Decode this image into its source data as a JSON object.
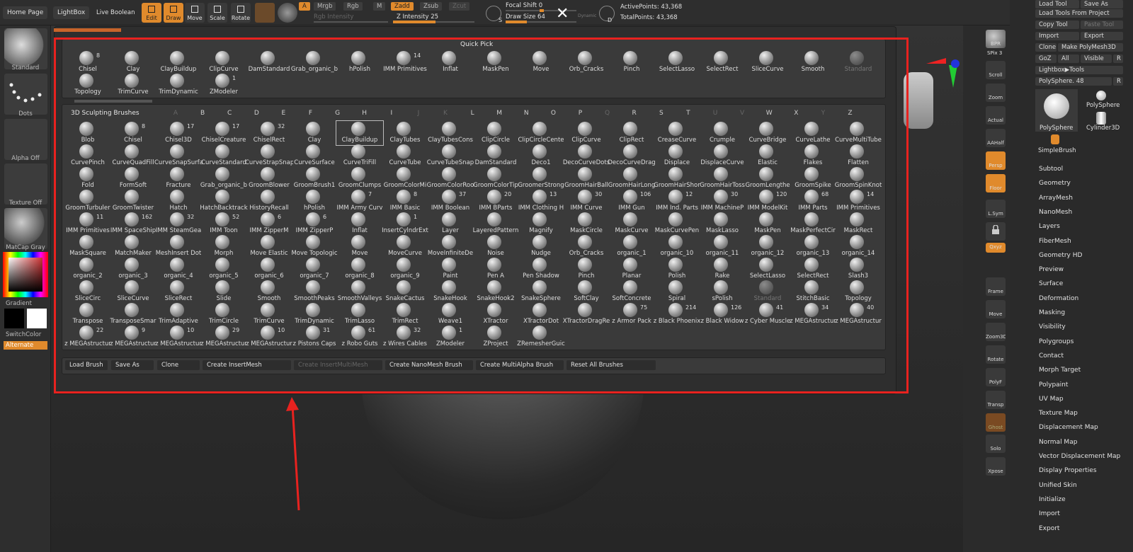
{
  "topbar": {
    "home": "Home Page",
    "lightbox": "LightBox",
    "live_boolean": "Live Boolean",
    "tools": [
      {
        "label": "Edit",
        "icon": "edit-icon",
        "on": true
      },
      {
        "label": "Draw",
        "icon": "draw-icon",
        "on": true
      },
      {
        "label": "Move",
        "icon": "move-icon",
        "on": false
      },
      {
        "label": "Scale",
        "icon": "scale-icon",
        "on": false
      },
      {
        "label": "Rotate",
        "icon": "rotate-icon",
        "on": false
      }
    ],
    "a_label": "A",
    "mrgb": "Mrgb",
    "rgb": "Rgb",
    "m": "M",
    "zadd": "Zadd",
    "zsub": "Zsub",
    "zcut": "Zcut",
    "rgb_intensity": "Rgb Intensity",
    "z_intensity": "Z Intensity 25",
    "focal_shift": "Focal Shift 0",
    "draw_size": "Draw Size 64",
    "s_label": "S",
    "d_label": "D",
    "dynamic": "Dynamic",
    "active_points": "ActivePoints: 43,368",
    "total_points": "TotalPoints: 43,368",
    "close": "✕"
  },
  "left": {
    "standard": "Standard",
    "dots": "Dots",
    "alpha": "Alpha Off",
    "texture": "Texture Off",
    "matcap": "MatCap Gray",
    "gradient": "Gradient",
    "switch": "SwitchColor",
    "alternate": "Alternate"
  },
  "quick_pick": {
    "title": "Quick Pick",
    "items": [
      {
        "n": "Chisel",
        "c": "8"
      },
      {
        "n": "Clay",
        "c": ""
      },
      {
        "n": "ClayBuildup",
        "c": ""
      },
      {
        "n": "ClipCurve",
        "c": ""
      },
      {
        "n": "DamStandard",
        "c": ""
      },
      {
        "n": "Grab_organic_b",
        "c": ""
      },
      {
        "n": "hPolish",
        "c": ""
      },
      {
        "n": "IMM Primitives",
        "c": "14"
      },
      {
        "n": "Inflat",
        "c": ""
      },
      {
        "n": "MaskPen",
        "c": ""
      },
      {
        "n": "Move",
        "c": ""
      },
      {
        "n": "Orb_Cracks",
        "c": ""
      },
      {
        "n": "Pinch",
        "c": ""
      },
      {
        "n": "SelectLasso",
        "c": ""
      },
      {
        "n": "SelectRect",
        "c": ""
      },
      {
        "n": "SliceCurve",
        "c": ""
      },
      {
        "n": "Smooth",
        "c": ""
      },
      {
        "n": "Standard",
        "c": "",
        "dim": true
      },
      {
        "n": "Topology",
        "c": ""
      },
      {
        "n": "TrimCurve",
        "c": ""
      },
      {
        "n": "TrimDynamic",
        "c": ""
      },
      {
        "n": "ZModeler",
        "c": "1"
      }
    ]
  },
  "brushes": {
    "title": "3D Sculpting Brushes",
    "letters": [
      "A",
      "B",
      "C",
      "D",
      "E",
      "F",
      "G",
      "H",
      "I",
      "J",
      "K",
      "L",
      "M",
      "N",
      "O",
      "P",
      "Q",
      "R",
      "S",
      "T",
      "U",
      "V",
      "W",
      "X",
      "Y",
      "Z"
    ],
    "dim_letters": [
      "A",
      "J",
      "K",
      "Q",
      "U",
      "V",
      "Y"
    ],
    "rows": [
      [
        {
          "n": "Blob"
        },
        {
          "n": "Chisel",
          "c": "8"
        },
        {
          "n": "Chisel3D",
          "c": "17"
        },
        {
          "n": "ChiselCreature",
          "c": "17"
        },
        {
          "n": "ChiselRect",
          "c": "32"
        },
        {
          "n": "Clay"
        },
        {
          "n": "ClayBuildup",
          "sel": true
        },
        {
          "n": "ClayTubes"
        },
        {
          "n": "ClayTubesCons"
        },
        {
          "n": "ClipCircle"
        },
        {
          "n": "ClipCircleCente"
        },
        {
          "n": "ClipCurve"
        },
        {
          "n": "ClipRect"
        },
        {
          "n": "CreaseCurve"
        },
        {
          "n": "Crumple"
        },
        {
          "n": "CurveBridge"
        },
        {
          "n": "CurveLathe"
        },
        {
          "n": "CurveMultiTube"
        }
      ],
      [
        {
          "n": "CurvePinch"
        },
        {
          "n": "CurveQuadFill"
        },
        {
          "n": "CurveSnapSurfa"
        },
        {
          "n": "CurveStandard"
        },
        {
          "n": "CurveStrapSnap"
        },
        {
          "n": "CurveSurface"
        },
        {
          "n": "CurveTriFill"
        },
        {
          "n": "CurveTube"
        },
        {
          "n": "CurveTubeSnap"
        },
        {
          "n": "DamStandard"
        },
        {
          "n": "Deco1"
        },
        {
          "n": "DecoCurveDots"
        },
        {
          "n": "DecoCurveDrag"
        },
        {
          "n": "Displace"
        },
        {
          "n": "DisplaceCurve"
        },
        {
          "n": "Elastic"
        },
        {
          "n": "Flakes"
        },
        {
          "n": "Flatten"
        }
      ],
      [
        {
          "n": "Fold"
        },
        {
          "n": "FormSoft"
        },
        {
          "n": "Fracture"
        },
        {
          "n": "Grab_organic_b"
        },
        {
          "n": "GroomBlower"
        },
        {
          "n": "GroomBrush1"
        },
        {
          "n": "GroomClumps"
        },
        {
          "n": "GroomColorMi"
        },
        {
          "n": "GroomColorRoo"
        },
        {
          "n": "GroomColorTip"
        },
        {
          "n": "GroomerStrong"
        },
        {
          "n": "GroomHairBall"
        },
        {
          "n": "GroomHairLong"
        },
        {
          "n": "GroomHairShor"
        },
        {
          "n": "GroomHairToss"
        },
        {
          "n": "GroomLengthe"
        },
        {
          "n": "GroomSpike"
        },
        {
          "n": "GroomSpinKnot"
        }
      ],
      [
        {
          "n": "GroomTurbuler"
        },
        {
          "n": "GroomTwister"
        },
        {
          "n": "Hatch"
        },
        {
          "n": "HatchBacktrack"
        },
        {
          "n": "HistoryRecall"
        },
        {
          "n": "hPolish"
        },
        {
          "n": "IMM Army Curv",
          "c": "7"
        },
        {
          "n": "IMM Basic",
          "c": "8"
        },
        {
          "n": "IMM Boolean",
          "c": "37"
        },
        {
          "n": "IMM BParts",
          "c": "20"
        },
        {
          "n": "IMM Clothing H",
          "c": "13"
        },
        {
          "n": "IMM Curve",
          "c": "30"
        },
        {
          "n": "IMM Gun",
          "c": "106"
        },
        {
          "n": "IMM Ind. Parts",
          "c": "12"
        },
        {
          "n": "IMM MachineP",
          "c": "30"
        },
        {
          "n": "IMM ModelKit",
          "c": "120"
        },
        {
          "n": "IMM Parts",
          "c": "68"
        },
        {
          "n": "IMM Primitives",
          "c": "14"
        }
      ],
      [
        {
          "n": "IMM Primitives",
          "c": "11"
        },
        {
          "n": "IMM SpaceShip",
          "c": "162"
        },
        {
          "n": "IMM SteamGea",
          "c": "32"
        },
        {
          "n": "IMM Toon",
          "c": "52"
        },
        {
          "n": "IMM ZipperM",
          "c": "6"
        },
        {
          "n": "IMM ZipperP",
          "c": "6"
        },
        {
          "n": "Inflat"
        },
        {
          "n": "InsertCylndrExt",
          "c": "1"
        },
        {
          "n": "Layer"
        },
        {
          "n": "LayeredPattern"
        },
        {
          "n": "Magnify"
        },
        {
          "n": "MaskCircle"
        },
        {
          "n": "MaskCurve"
        },
        {
          "n": "MaskCurvePen"
        },
        {
          "n": "MaskLasso"
        },
        {
          "n": "MaskPen"
        },
        {
          "n": "MaskPerfectCir"
        },
        {
          "n": "MaskRect"
        }
      ],
      [
        {
          "n": "MaskSquare"
        },
        {
          "n": "MatchMaker"
        },
        {
          "n": "MeshInsert Dot"
        },
        {
          "n": "Morph"
        },
        {
          "n": "Move Elastic"
        },
        {
          "n": "Move Topologic"
        },
        {
          "n": "Move"
        },
        {
          "n": "MoveCurve"
        },
        {
          "n": "MoveInfiniteDe"
        },
        {
          "n": "Noise"
        },
        {
          "n": "Nudge"
        },
        {
          "n": "Orb_Cracks"
        },
        {
          "n": "organic_1"
        },
        {
          "n": "organic_10"
        },
        {
          "n": "organic_11"
        },
        {
          "n": "organic_12"
        },
        {
          "n": "organic_13"
        },
        {
          "n": "organic_14"
        }
      ],
      [
        {
          "n": "organic_2"
        },
        {
          "n": "organic_3"
        },
        {
          "n": "organic_4"
        },
        {
          "n": "organic_5"
        },
        {
          "n": "organic_6"
        },
        {
          "n": "organic_7"
        },
        {
          "n": "organic_8"
        },
        {
          "n": "organic_9"
        },
        {
          "n": "Paint"
        },
        {
          "n": "Pen A"
        },
        {
          "n": "Pen Shadow"
        },
        {
          "n": "Pinch"
        },
        {
          "n": "Planar"
        },
        {
          "n": "Polish"
        },
        {
          "n": "Rake"
        },
        {
          "n": "SelectLasso"
        },
        {
          "n": "SelectRect"
        },
        {
          "n": "Slash3"
        }
      ],
      [
        {
          "n": "SliceCirc"
        },
        {
          "n": "SliceCurve"
        },
        {
          "n": "SliceRect"
        },
        {
          "n": "Slide"
        },
        {
          "n": "Smooth"
        },
        {
          "n": "SmoothPeaks"
        },
        {
          "n": "SmoothValleys"
        },
        {
          "n": "SnakeCactus"
        },
        {
          "n": "SnakeHook"
        },
        {
          "n": "SnakeHook2"
        },
        {
          "n": "SnakeSphere"
        },
        {
          "n": "SoftClay"
        },
        {
          "n": "SoftConcrete"
        },
        {
          "n": "Spiral"
        },
        {
          "n": "sPolish"
        },
        {
          "n": "Standard",
          "dim": true
        },
        {
          "n": "StitchBasic"
        },
        {
          "n": "Topology"
        }
      ],
      [
        {
          "n": "Transpose"
        },
        {
          "n": "TransposeSmar"
        },
        {
          "n": "TrimAdaptive"
        },
        {
          "n": "TrimCircle"
        },
        {
          "n": "TrimCurve"
        },
        {
          "n": "TrimDynamic"
        },
        {
          "n": "TrimLasso"
        },
        {
          "n": "TrimRect"
        },
        {
          "n": "Weave1"
        },
        {
          "n": "XTractor"
        },
        {
          "n": "XTractorDot"
        },
        {
          "n": "XTractorDragRe"
        },
        {
          "n": "z Armor Pack",
          "c": "75"
        },
        {
          "n": "z Black Phoenix",
          "c": "214"
        },
        {
          "n": "z Black Widow",
          "c": "126"
        },
        {
          "n": "z Cyber Muscle",
          "c": "41"
        },
        {
          "n": "z MEGAstructur",
          "c": "34"
        },
        {
          "n": "z MEGAstructur",
          "c": "40"
        }
      ],
      [
        {
          "n": "z MEGAstructur",
          "c": "22"
        },
        {
          "n": "z MEGAstructur",
          "c": "9"
        },
        {
          "n": "z MEGAstructur",
          "c": "10"
        },
        {
          "n": "z MEGAstructur",
          "c": "29"
        },
        {
          "n": "z MEGAstructur",
          "c": "10"
        },
        {
          "n": "z Pistons Caps",
          "c": "31"
        },
        {
          "n": "z Robo Guts",
          "c": "61"
        },
        {
          "n": "z Wires Cables",
          "c": "32"
        },
        {
          "n": "ZModeler",
          "c": "1"
        },
        {
          "n": "ZProject"
        },
        {
          "n": "ZRemesherGuic"
        }
      ]
    ]
  },
  "bottom": {
    "load": "Load Brush",
    "save": "Save As",
    "clone": "Clone",
    "insert": "Create InsertMesh",
    "insert_multi": "Create InsertMultiMesh",
    "nano": "Create NanoMesh Brush",
    "multialpha": "Create MultiAlpha Brush",
    "reset": "Reset All Brushes"
  },
  "rightshelf": {
    "bpr": "BPR",
    "spix": "SPix 3",
    "scroll": "Scroll",
    "zoom": "Zoom",
    "actual": "Actual",
    "aahalf": "AAHalf",
    "persp": "Persp",
    "floor": "Floor",
    "lsym": "L.Sym",
    "xyz": "Qxyz",
    "frame": "Frame",
    "move": "Move",
    "zoom3d": "Zoom3D",
    "rotate": "Rotate",
    "polyf": "PolyF",
    "transp": "Transp",
    "ghost": "Ghost",
    "solo": "Solo",
    "xpose": "Xpose"
  },
  "tool_panel": {
    "load_tool": "Load Tool",
    "save_as": "Save As",
    "load_from_project": "Load Tools From Project",
    "copy_tool": "Copy Tool",
    "paste_tool": "Paste Tool",
    "import": "Import",
    "export": "Export",
    "clone": "Clone",
    "make_polymesh": "Make PolyMesh3D",
    "goz": "GoZ",
    "all": "All",
    "visible": "Visible",
    "r": "R",
    "lightbox_tools": "Lightbox▶Tools",
    "polysphere_slider": "PolySphere. 48",
    "polysphere": "PolySphere",
    "polysphere_small": "PolySphere",
    "cylinder": "Cylinder3D",
    "simplebrush": "SimpleBrush",
    "menu": [
      "Subtool",
      "Geometry",
      "ArrayMesh",
      "NanoMesh",
      "Layers",
      "FiberMesh",
      "Geometry HD",
      "Preview",
      "Surface",
      "Deformation",
      "Masking",
      "Visibility",
      "Polygroups",
      "Contact",
      "Morph Target",
      "Polypaint",
      "UV Map",
      "Texture Map",
      "Displacement Map",
      "Normal Map",
      "Vector Displacement Map",
      "Display Properties",
      "Unified Skin",
      "Initialize",
      "Import",
      "Export"
    ]
  },
  "colors": {
    "accent": "#e08a2c",
    "annotation": "#e8221f"
  }
}
